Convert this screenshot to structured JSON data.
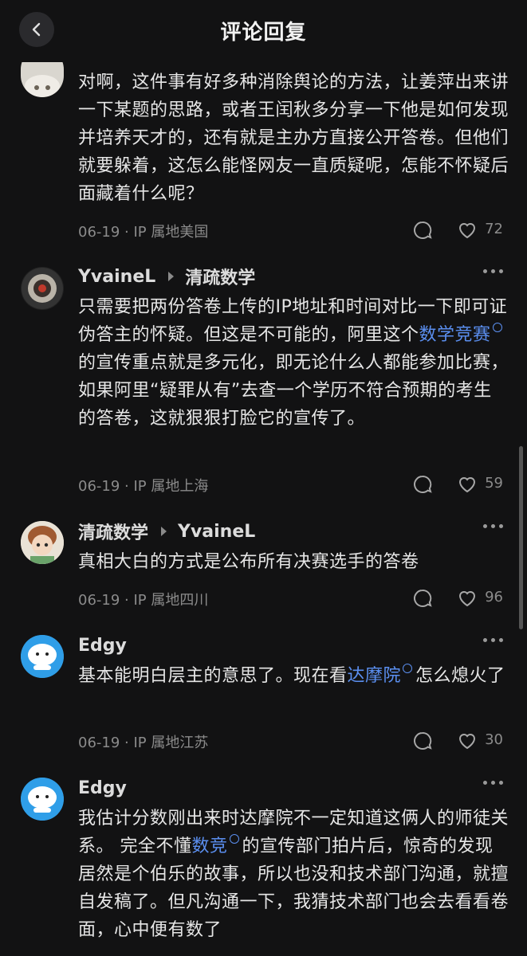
{
  "header": {
    "title": "评论回复"
  },
  "comments": [
    {
      "text_parts": [
        "对啊，这件事有好多种消除舆论的方法，让姜萍出来讲一下某题的思路，或者王闰秋多分享一下他是如何发现并培养天才的，还有就是主办方直接公开答卷。但他们就要躲着，这怎么能怪网友一直质疑呢，怎能不怀疑后面藏着什么呢？"
      ],
      "meta": "06-19 · IP 属地美国",
      "likes": "72"
    },
    {
      "user": "YvaineL",
      "reply_to": "清疏数学",
      "text_parts": [
        "只需要把两份答卷上传的IP地址和时间对比一下即可证伪答主的怀疑。但这是不可能的，阿里这个",
        "的宣传重点就是多元化，即无论什么人都能参加比赛，如果阿里“疑罪从有”去查一个学历不符合预期的考生的答卷，这就狠狠打脸它的宣传了。"
      ],
      "link": "数学竞赛",
      "meta": "06-19 · IP 属地上海",
      "likes": "59"
    },
    {
      "user": "清疏数学",
      "reply_to": "YvaineL",
      "text_parts": [
        "真相大白的方式是公布所有决赛选手的答卷"
      ],
      "meta": "06-19 · IP 属地四川",
      "likes": "96"
    },
    {
      "user": "Edgy",
      "text_parts": [
        "基本能明白层主的意思了。现在看",
        "怎么熄火了"
      ],
      "link": "达摩院",
      "meta": "06-19 · IP 属地江苏",
      "likes": "30"
    },
    {
      "user": "Edgy",
      "text_parts": [
        "我估计分数刚出来时达摩院不一定知道这俩人的师徒关系。 完全不懂",
        "的宣传部门拍片后，惊奇的发现居然是个伯乐的故事，所以也没和技术部门沟通，就擅自发稿了。但凡沟通一下，我猜技术部门也会去看看卷面，心中便有数了"
      ],
      "link": "数竞"
    }
  ],
  "colors": {
    "background": "#121213",
    "link": "#5b8ff0",
    "meta": "#8b8b8b"
  },
  "icons": [
    "chevron-left-icon",
    "comment-bubble-icon",
    "heart-icon",
    "more-dots-icon",
    "search-link-icon"
  ]
}
